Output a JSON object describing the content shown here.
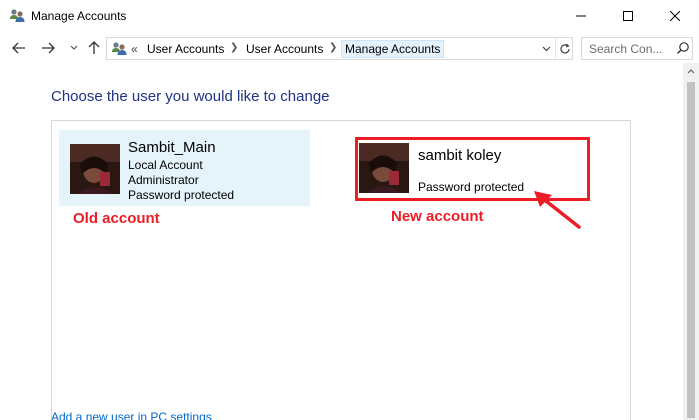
{
  "window": {
    "title": "Manage Accounts"
  },
  "address_bar": {
    "overflow_marker": "«",
    "breadcrumbs": [
      "User Accounts",
      "User Accounts",
      "Manage Accounts"
    ]
  },
  "search": {
    "placeholder": "Search Con..."
  },
  "content": {
    "heading": "Choose the user you would like to change",
    "accounts": [
      {
        "name": "Sambit_Main",
        "lines": [
          "Local Account",
          "Administrator",
          "Password protected"
        ]
      },
      {
        "name": "sambit koley",
        "lines": [
          "Password protected"
        ]
      }
    ],
    "add_user_link": "Add a new user in PC settings"
  },
  "annotations": {
    "old_label": "Old account",
    "new_label": "New account",
    "color": "#ee1c25"
  },
  "colors": {
    "heading": "#1e3287",
    "selected_bg": "#e5f3fb",
    "link": "#0066cc"
  }
}
